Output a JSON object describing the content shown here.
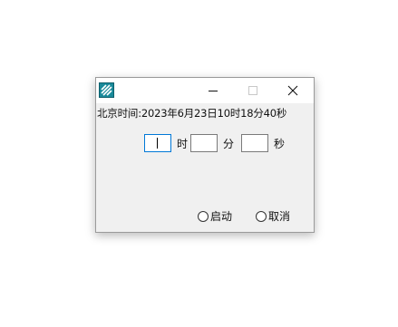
{
  "window": {
    "icon": "app-icon",
    "controls": {
      "minimize_icon": "minimize-icon",
      "maximize_icon": "maximize-icon",
      "close_icon": "close-icon"
    }
  },
  "clock": {
    "label": "北京时间:2023年6月23日10时18分40秒"
  },
  "time_inputs": {
    "hour": {
      "value": "",
      "unit": "时"
    },
    "minute": {
      "value": "",
      "unit": "分"
    },
    "second": {
      "value": "",
      "unit": "秒"
    }
  },
  "options": {
    "start_label": "启动",
    "cancel_label": "取消"
  },
  "colors": {
    "accent": "#0078d7",
    "window_bg": "#f0f0f0",
    "icon_teal": "#1a8a9a"
  }
}
